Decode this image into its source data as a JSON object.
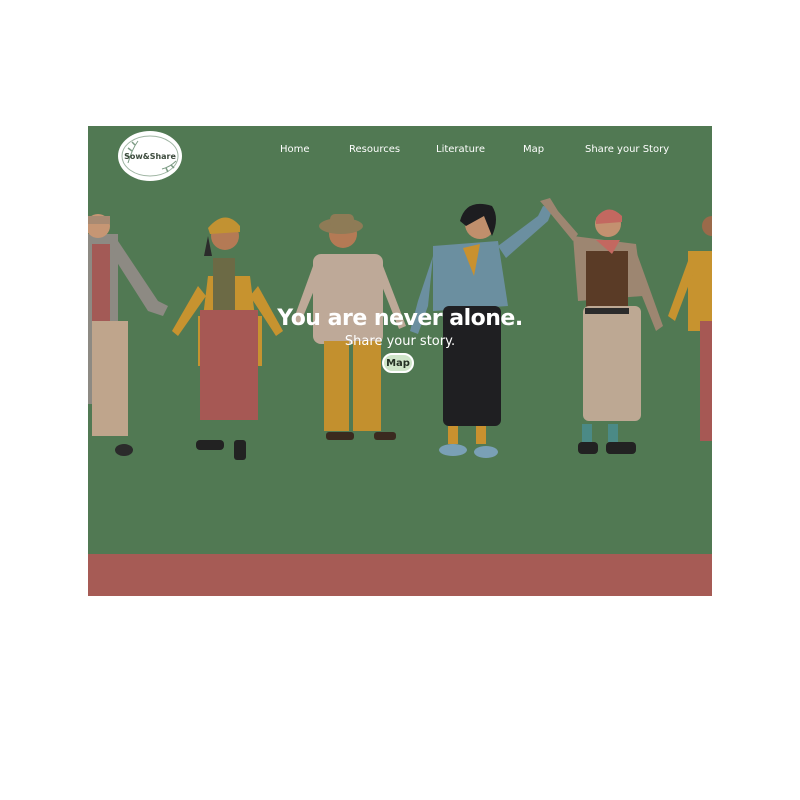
{
  "logo": {
    "text": "Sow&Share"
  },
  "nav": {
    "items": [
      {
        "label": "Home"
      },
      {
        "label": "Resources"
      },
      {
        "label": "Literature"
      },
      {
        "label": "Map"
      },
      {
        "label": "Share your Story"
      }
    ]
  },
  "hero": {
    "title": "You are never alone.",
    "subtitle": "Share your story.",
    "button_label": "Map",
    "illustration": "people-holding-hands-illustration"
  },
  "colors": {
    "hero_background": "#517953",
    "footer_band": "#a65b55",
    "button_fill": "#cfe5c9",
    "text": "#ffffff"
  }
}
